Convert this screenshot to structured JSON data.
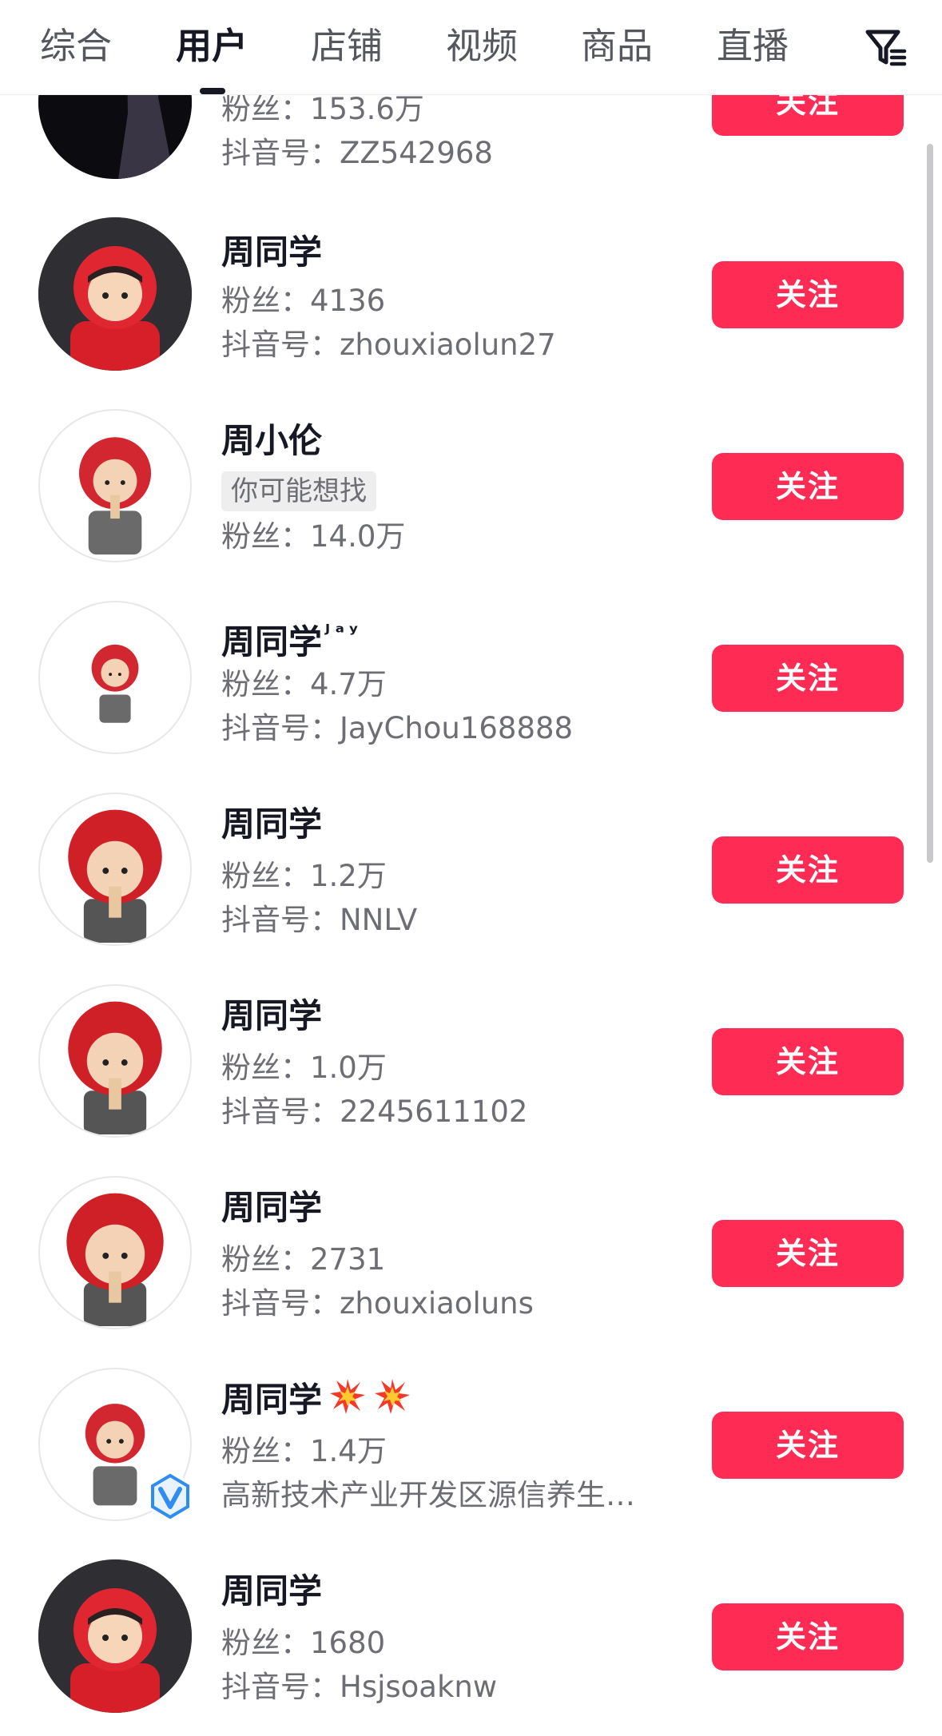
{
  "tabs": [
    {
      "label": "综合"
    },
    {
      "label": "用户"
    },
    {
      "label": "店铺"
    },
    {
      "label": "视频"
    },
    {
      "label": "商品"
    },
    {
      "label": "直播"
    }
  ],
  "active_tab": "用户",
  "labels": {
    "fans_prefix": "粉丝：",
    "id_prefix": "抖音号：",
    "follow": "关注",
    "maybe_looking_for": "你可能想找"
  },
  "users": [
    {
      "name": "",
      "fans": "153.6万",
      "id": "ZZ542968"
    },
    {
      "name": "周同学",
      "fans": "4136",
      "id": "zhouxiaolun27"
    },
    {
      "name": "周小伦",
      "hint": "你可能想找",
      "fans": "14.0万"
    },
    {
      "name": "周同学",
      "name_suffix": "ᴶᵃʸ",
      "fans": "4.7万",
      "id": "JayChou168888"
    },
    {
      "name": "周同学",
      "fans": "1.2万",
      "id": "NNLV"
    },
    {
      "name": "周同学",
      "fans": "1.0万",
      "id": "2245611102"
    },
    {
      "name": "周同学",
      "fans": "2731",
      "id": "zhouxiaoluns"
    },
    {
      "name": "周同学",
      "fans": "1.4万",
      "description": "高新技术产业开发区源信养生…",
      "verified": true
    },
    {
      "name": "周同学",
      "fans": "1680",
      "id": "Hsjsoaknw"
    }
  ],
  "icons": {
    "filter": "filter-icon",
    "verified": "verified-badge-icon",
    "emoji": "collision-emoji-icon"
  },
  "colors": {
    "follow_button": "#fe2c55",
    "primary_text": "#161823",
    "secondary_text": "#6d6e74",
    "verified_blue": "#2f8cf0"
  }
}
